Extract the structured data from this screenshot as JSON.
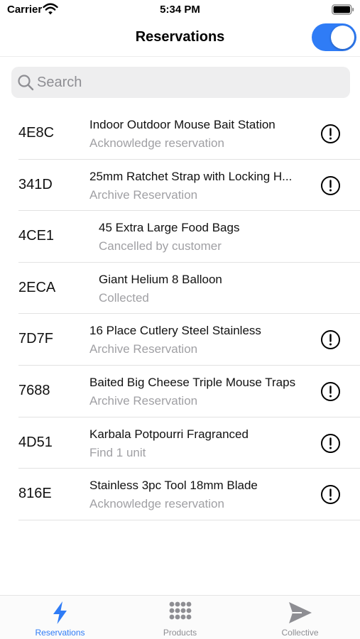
{
  "status": {
    "carrier": "Carrier",
    "time": "5:34 PM"
  },
  "nav": {
    "title": "Reservations",
    "toggle_on": true
  },
  "search": {
    "placeholder": "Search",
    "value": ""
  },
  "reservations": [
    {
      "code": "4E8C",
      "title": "Indoor Outdoor Mouse Bait Station",
      "status": "Acknowledge reservation",
      "alert": true
    },
    {
      "code": "341D",
      "title": "25mm Ratchet Strap with Locking H...",
      "status": "Archive Reservation",
      "alert": true
    },
    {
      "code": "4CE1",
      "title": "45 Extra Large Food Bags",
      "status": "Cancelled by customer",
      "alert": false
    },
    {
      "code": "2ECA",
      "title": "Giant Helium 8 Balloon",
      "status": "Collected",
      "alert": false
    },
    {
      "code": "7D7F",
      "title": "16 Place Cutlery Steel Stainless",
      "status": "Archive Reservation",
      "alert": true
    },
    {
      "code": "7688",
      "title": "Baited Big Cheese Triple Mouse Traps",
      "status": "Archive Reservation",
      "alert": true
    },
    {
      "code": "4D51",
      "title": "Karbala Potpourri Fragranced",
      "status": "Find 1 unit",
      "alert": true
    },
    {
      "code": "816E",
      "title": "Stainless 3pc Tool 18mm Blade",
      "status": "Acknowledge reservation",
      "alert": true
    }
  ],
  "tabs": [
    {
      "label": "Reservations",
      "icon": "bolt-icon",
      "active": true
    },
    {
      "label": "Products",
      "icon": "grid-dots-icon",
      "active": false
    },
    {
      "label": "Collective",
      "icon": "send-icon",
      "active": false
    }
  ],
  "colors": {
    "accent": "#2f7cf6",
    "secondary_text": "#a0a0a4",
    "inactive_tab": "#8e8e93"
  }
}
